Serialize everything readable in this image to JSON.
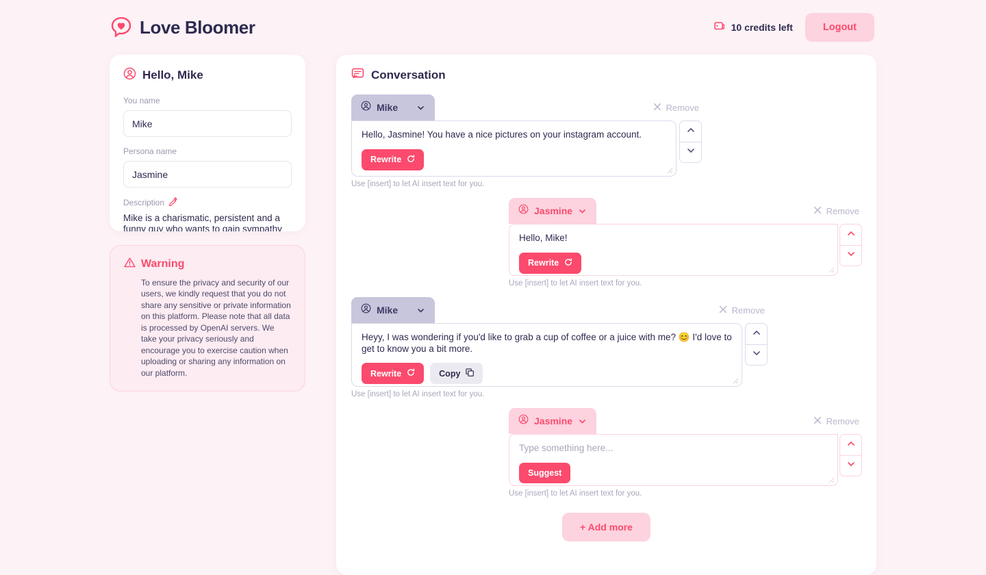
{
  "header": {
    "brand_name": "Love Bloomer",
    "logo_icon": "heart-speech-bubble-icon",
    "credits_icon": "wallet-icon",
    "credits_text": "10 credits left",
    "logout_label": "Logout"
  },
  "colors": {
    "page_bg": "#fdf2f6",
    "accent_pink": "#fb4a6d",
    "accent_pink_soft": "#fcd3de",
    "navy": "#2e2a4f",
    "mike_tab": "#c8c6dd",
    "muted": "#a9a7bb"
  },
  "sidebar": {
    "profile": {
      "icon": "user-circle-icon",
      "title": "Hello, Mike",
      "you_name_label": "You name",
      "you_name_value": "Mike",
      "persona_name_label": "Persona name",
      "persona_name_value": "Jasmine",
      "description_label": "Description",
      "description_edit_icon": "pencil-icon",
      "description_value": "Mike is a charismatic, persistent and a funny guy who wants to gain sympathy from Jasm..."
    },
    "warning": {
      "icon": "warning-triangle-icon",
      "title": "Warning",
      "body": "To ensure the privacy and security of our users, we kindly request that you do not share any sensitive or private information on this platform. Please note that all data is processed by OpenAI servers. We take your privacy seriously and encourage you to exercise caution when uploading or sharing any information on our platform."
    }
  },
  "conversation": {
    "icon": "chat-bubble-icon",
    "title": "Conversation",
    "remove_label": "Remove",
    "remove_icon": "close-x-icon",
    "hint": "Use [insert] to let AI insert text for you.",
    "textarea_placeholder": "Type something here...",
    "move_up_icon": "chevron-up-icon",
    "move_down_icon": "chevron-down-icon",
    "speaker_dropdown_icon": "chevron-down-icon",
    "speaker_avatar_icon": "user-circle-icon",
    "add_more_label": "+ Add more",
    "messages": [
      {
        "speaker": "Mike",
        "side": "left",
        "text": "Hello, Jasmine! You have a nice pictures on your instagram account.",
        "placeholder": "",
        "buttons": [
          {
            "label": "Rewrite",
            "icon": "refresh-icon",
            "style": "primary"
          }
        ]
      },
      {
        "speaker": "Jasmine",
        "side": "right",
        "text": "Hello, Mike!",
        "placeholder": "",
        "buttons": [
          {
            "label": "Rewrite",
            "icon": "refresh-icon",
            "style": "primary"
          }
        ]
      },
      {
        "speaker": "Mike",
        "side": "left",
        "text": "Heyy, I was wondering if you'd like to grab a cup of coffee or a juice with me? 😊  I'd love to get to know you a bit more.",
        "placeholder": "",
        "buttons": [
          {
            "label": "Rewrite",
            "icon": "refresh-icon",
            "style": "primary"
          },
          {
            "label": "Copy",
            "icon": "copy-icon",
            "style": "secondary"
          }
        ]
      },
      {
        "speaker": "Jasmine",
        "side": "right",
        "text": "",
        "placeholder": "Type something here...",
        "buttons": [
          {
            "label": "Suggest",
            "icon": "",
            "style": "primary"
          }
        ]
      }
    ]
  }
}
